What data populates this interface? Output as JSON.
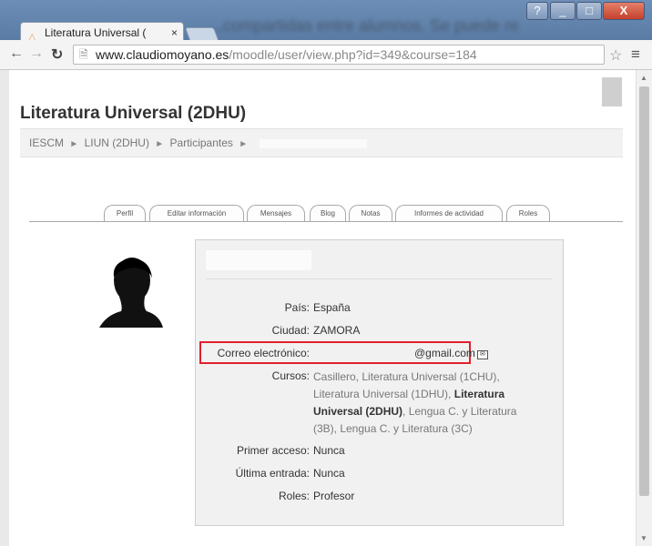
{
  "browser": {
    "tab_title": "Literatura Universal (",
    "tab_close": "×",
    "background_text": "...compartidas entre alumnos. Se puede realizar mas...",
    "url_host": "www.claudiomoyano.es",
    "url_path": "/moodle/user/view.php?id=349&course=184",
    "window_buttons": [
      "?",
      "_",
      "□",
      "X"
    ]
  },
  "page": {
    "title": "Literatura Universal (2DHU)",
    "breadcrumb": [
      "IESCM",
      "LIUN (2DHU)",
      "Participantes"
    ],
    "breadcrumb_sep": "►"
  },
  "tabs": [
    "Perfil",
    "Editar información",
    "Mensajes",
    "Blog",
    "Notas",
    "Informes de actividad",
    "Roles"
  ],
  "profile": {
    "fields": {
      "pais_label": "País:",
      "pais_value": "España",
      "ciudad_label": "Ciudad:",
      "ciudad_value": "ZAMORA",
      "correo_label": "Correo electrónico:",
      "correo_value": "@gmail.com",
      "cursos_label": "Cursos:",
      "primer_label": "Primer acceso:",
      "primer_value": "Nunca",
      "ultima_label": "Última entrada:",
      "ultima_value": "Nunca",
      "roles_label": "Roles:",
      "roles_value": "Profesor"
    },
    "courses": {
      "part1": "Casillero, Literatura Universal (1CHU), Literatura Universal (1DHU),",
      "current": "Literatura Universal (2DHU)",
      "part2": ", Lengua C. y Literatura (3B), Lengua C. y Literatura (3C)"
    }
  },
  "colors": {
    "highlight": "#e0202c",
    "titlebar": "#6d8fb7"
  }
}
